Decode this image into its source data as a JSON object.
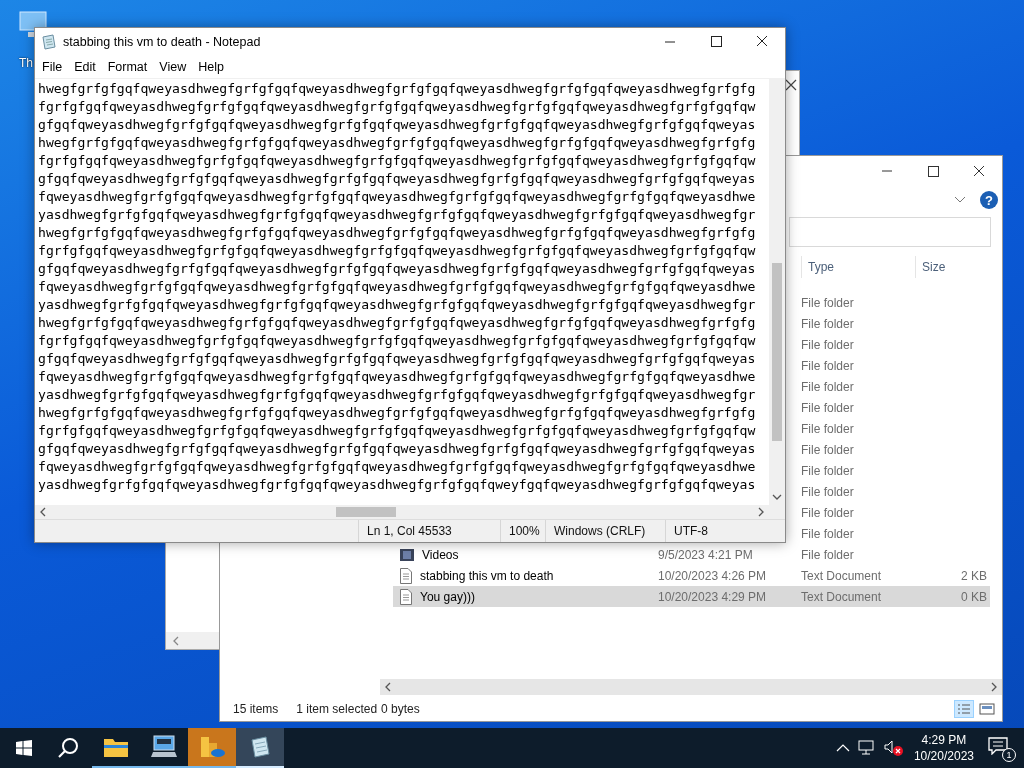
{
  "desktop": {
    "icons": [
      {
        "label": "Th"
      }
    ]
  },
  "explorer": {
    "help_button": "?",
    "columns": {
      "type": "Type",
      "size": "Size"
    },
    "rows": [
      {
        "type": "File folder",
        "selected": false
      },
      {
        "type": "File folder",
        "selected": false
      },
      {
        "type": "File folder",
        "selected": false
      },
      {
        "type": "File folder",
        "selected": false
      },
      {
        "type": "File folder",
        "selected": false
      },
      {
        "type": "File folder",
        "selected": false
      },
      {
        "type": "File folder",
        "selected": false
      },
      {
        "type": "File folder",
        "selected": false
      },
      {
        "type": "File folder",
        "selected": false
      },
      {
        "type": "File folder",
        "selected": false
      },
      {
        "type": "File folder",
        "selected": false
      },
      {
        "type": "File folder",
        "selected": false
      },
      {
        "kind": "videos",
        "name": "Videos",
        "date": "9/5/2023 4:21 PM",
        "type": "File folder",
        "selected": false
      },
      {
        "kind": "text",
        "name": "stabbing this vm to death",
        "date": "10/20/2023 4:26 PM",
        "type": "Text Document",
        "size": "2 KB",
        "selected": false
      },
      {
        "kind": "text",
        "name": "You gay)))",
        "date": "10/20/2023 4:29 PM",
        "type": "Text Document",
        "size": "0 KB",
        "selected": true
      }
    ],
    "status": {
      "items": "15 items",
      "selection": "1 item selected",
      "size": "0 bytes"
    }
  },
  "notepad": {
    "title": "stabbing this vm to death - Notepad",
    "menu": [
      "File",
      "Edit",
      "Format",
      "View",
      "Help"
    ],
    "lines": [
      "hwegfgrfgfgqfqweyasdhwegfgrfgfgqfqweyasdhwegfgrfgfgqfqweyasdhwegfgrfgfgqfqweyasdhwegfgrfgfg",
      "fgrfgfgqfqweyasdhwegfgrfgfgqfqweyasdhwegfgrfgfgqfqweyasdhwegfgrfgfgqfqweyasdhwegfgrfgfgqfqw",
      "gfgqfqweyasdhwegfgrfgfgqfqweyasdhwegfgrfgfgqfqweyasdhwegfgrfgfgqfqweyasdhwegfgrfgfgqfqweyas",
      "hwegfgrfgfgqfqweyasdhwegfgrfgfgqfqweyasdhwegfgrfgfgqfqweyasdhwegfgrfgfgqfqweyasdhwegfgrfgfg",
      "fgrfgfgqfqweyasdhwegfgrfgfgqfqweyasdhwegfgrfgfgqfqweyasdhwegfgrfgfgqfqweyasdhwegfgrfgfgqfqw",
      "gfgqfqweyasdhwegfgrfgfgqfqweyasdhwegfgrfgfgqfqweyasdhwegfgrfgfgqfqweyasdhwegfgrfgfgqfqweyas",
      "fqweyasdhwegfgrfgfgqfqweyasdhwegfgrfgfgqfqweyasdhwegfgrfgfgqfqweyasdhwegfgrfgfgqfqweyasdhwe",
      "yasdhwegfgrfgfgqfqweyasdhwegfgrfgfgqfqweyasdhwegfgrfgfgqfqweyasdhwegfgrfgfgqfqweyasdhwegfgr",
      "hwegfgrfgfgqfqweyasdhwegfgrfgfgqfqweyasdhwegfgrfgfgqfqweyasdhwegfgrfgfgqfqweyasdhwegfgrfgfg",
      "fgrfgfgqfqweyasdhwegfgrfgfgqfqweyasdhwegfgrfgfgqfqweyasdhwegfgrfgfgqfqweyasdhwegfgrfgfgqfqw",
      "gfgqfqweyasdhwegfgrfgfgqfqweyasdhwegfgrfgfgqfqweyasdhwegfgrfgfgqfqweyasdhwegfgrfgfgqfqweyas",
      "fqweyasdhwegfgrfgfgqfqweyasdhwegfgrfgfgqfqweyasdhwegfgrfgfgqfqweyasdhwegfgrfgfgqfqweyasdhwe",
      "yasdhwegfgrfgfgqfqweyasdhwegfgrfgfgqfqweyasdhwegfgrfgfgqfqweyasdhwegfgrfgfgqfqweyasdhwegfgr",
      "hwegfgrfgfgqfqweyasdhwegfgrfgfgqfqweyasdhwegfgrfgfgqfqweyasdhwegfgrfgfgqfqweyasdhwegfgrfgfg",
      "fgrfgfgqfqweyasdhwegfgrfgfgqfqweyasdhwegfgrfgfgqfqweyasdhwegfgrfgfgqfqweyasdhwegfgrfgfgqfqw",
      "gfgqfqweyasdhwegfgrfgfgqfqweyasdhwegfgrfgfgqfqweyasdhwegfgrfgfgqfqweyasdhwegfgrfgfgqfqweyas",
      "fqweyasdhwegfgrfgfgqfqweyasdhwegfgrfgfgqfqweyasdhwegfgrfgfgqfqweyasdhwegfgrfgfgqfqweyasdhwe",
      "yasdhwegfgrfgfgqfqweyasdhwegfgrfgfgqfqweyasdhwegfgrfgfgqfqweyasdhwegfgrfgfgqfqweyasdhwegfgr",
      "hwegfgrfgfgqfqweyasdhwegfgrfgfgqfqweyasdhwegfgrfgfgqfqweyasdhwegfgrfgfgqfqweyasdhwegfgrfgfg",
      "fgrfgfgqfqweyasdhwegfgrfgfgqfqweyasdhwegfgrfgfgqfqweyasdhwegfgrfgfgqfqweyasdhwegfgrfgfgqfqw",
      "gfgqfqweyasdhwegfgrfgfgqfqweyasdhwegfgrfgfgqfqweyasdhwegfgrfgfgqfqweyasdhwegfgrfgfgqfqweyas",
      "fqweyasdhwegfgrfgfgqfqweyasdhwegfgrfgfgqfqweyasdhwegfgrfgfgqfqweyasdhwegfgrfgfgqfqweyasdhwe",
      "yasdhwegfgrfgfgqfqweyasdhwegfgrfgfgqfqweyasdhwegfgrfgfgqfqweyfgqfqweyasdhwegfgrfgfgqfqweyas"
    ],
    "status": {
      "position": "Ln 1, Col 45533",
      "zoom": "100%",
      "line_endings": "Windows (CRLF)",
      "encoding": "UTF-8"
    }
  },
  "taskbar": {
    "apps": [
      {
        "kind": "explorer",
        "selected": false,
        "flashing": false
      },
      {
        "kind": "computer",
        "selected": false,
        "flashing": false
      },
      {
        "kind": "explorer-cloud",
        "selected": false,
        "flashing": true
      },
      {
        "kind": "notepad",
        "selected": true,
        "flashing": false
      }
    ],
    "tray": {
      "volume_muted": true,
      "time": "4:29 PM",
      "date": "10/20/2023",
      "notifications": "1"
    }
  }
}
